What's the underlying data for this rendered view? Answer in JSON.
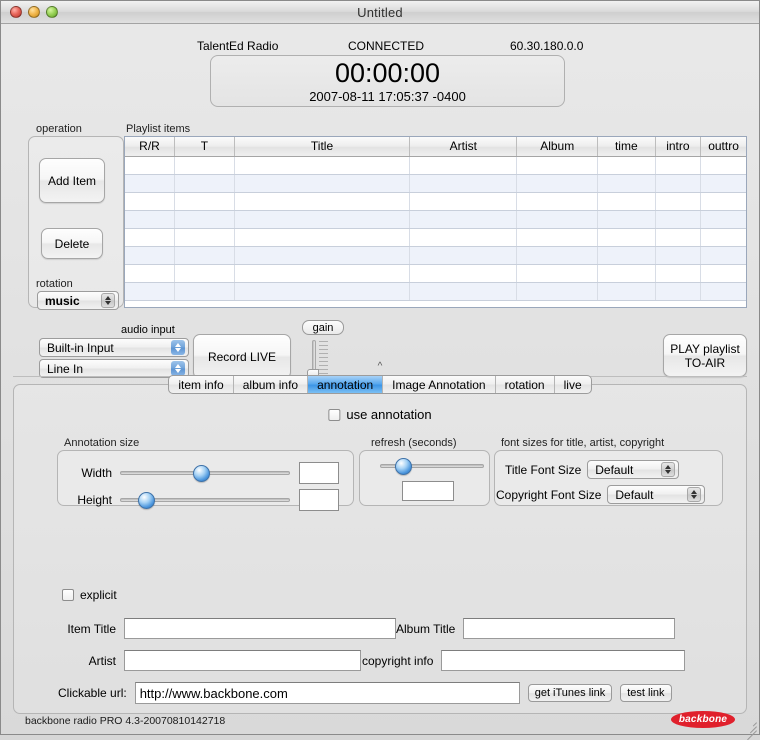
{
  "window": {
    "title": "Untitled",
    "traffic_lights": [
      "close",
      "minimize",
      "zoom"
    ]
  },
  "status": {
    "station": "TalentEd Radio",
    "connection": "CONNECTED",
    "ip": "60.30.180.0.0"
  },
  "timer": {
    "elapsed": "00:00:00",
    "timestamp": "2007-08-11 17:05:37 -0400"
  },
  "operation": {
    "label": "operation",
    "add_item": "Add Item",
    "delete": "Delete",
    "rotation_label": "rotation",
    "rotation_value": "music"
  },
  "playlist": {
    "label": "Playlist items",
    "columns": [
      "R/R",
      "T",
      "Title",
      "Artist",
      "Album",
      "time",
      "intro",
      "outtro"
    ],
    "rows": [],
    "empty_row_count": 8
  },
  "audio": {
    "input_label": "audio input",
    "device": "Built-in Input",
    "source": "Line In",
    "record_button": "Record LIVE",
    "gain_label": "gain"
  },
  "play": {
    "line1": "PLAY playlist",
    "line2": "TO-AIR"
  },
  "collapse": {
    "chevron": "^"
  },
  "tabs": [
    {
      "label": "item info",
      "active": false
    },
    {
      "label": "album info",
      "active": false
    },
    {
      "label": "annotation",
      "active": true
    },
    {
      "label": "Image Annotation",
      "active": false
    },
    {
      "label": "rotation",
      "active": false
    },
    {
      "label": "live",
      "active": false
    }
  ],
  "annotation": {
    "use_annotation_label": "use annotation",
    "use_annotation_checked": false,
    "size_group_label": "Annotation size",
    "width_label": "Width",
    "width_value": "",
    "width_thumb_pct": 47,
    "height_label": "Height",
    "height_value": "",
    "height_thumb_pct": 11,
    "refresh_group_label": "refresh (seconds)",
    "refresh_value": "",
    "refresh_thumb_pct": 16,
    "fonts_group_label": "font sizes for title, artist, copyright",
    "title_font_label": "Title Font Size",
    "title_font_value": "Default",
    "copyright_font_label": "Copyright Font Size",
    "copyright_font_value": "Default",
    "explicit_label": "explicit",
    "explicit_checked": false,
    "item_title_label": "Item Title",
    "item_title_value": "",
    "album_title_label": "Album Title",
    "album_title_value": "",
    "artist_label": "Artist",
    "artist_value": "",
    "copyright_label": "copyright info",
    "copyright_value": "",
    "url_label": "Clickable url:",
    "url_value": "http://www.backbone.com",
    "get_itunes_link": "get iTunes link",
    "test_link": "test link"
  },
  "footer": {
    "version": "backbone radio PRO 4.3-20070810142718",
    "logo_text": "backbone"
  },
  "colors": {
    "accent_blue": "#3d95e6",
    "brand_red": "#e0202c",
    "row_alt": "#eef2fa"
  }
}
